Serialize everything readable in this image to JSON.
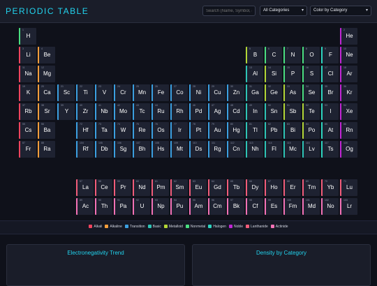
{
  "header": {
    "title": "PERIODIC TABLE",
    "search_placeholder": "Search (Name, Symbol, #",
    "category_select": "All Categories",
    "color_select": "Color by Category",
    "chevron": "▾"
  },
  "colors": {
    "alkali": "#f0445e",
    "alkaline": "#f59e3b",
    "transition": "#3b9fe0",
    "basic": "#2ec4b6",
    "metalloid": "#b3d636",
    "nonmetal": "#4ade80",
    "halogen": "#2dd4bf",
    "noble": "#c026d3",
    "lanthanide": "#f25c7a",
    "actinide": "#f472b6"
  },
  "elements": [
    {
      "n": "1",
      "s": "H",
      "r": 1,
      "c": 1,
      "cat": "nonmetal"
    },
    {
      "n": "2",
      "s": "He",
      "r": 1,
      "c": 18,
      "cat": "noble"
    },
    {
      "n": "3",
      "s": "Li",
      "r": 2,
      "c": 1,
      "cat": "alkali"
    },
    {
      "n": "4",
      "s": "Be",
      "r": 2,
      "c": 2,
      "cat": "alkaline"
    },
    {
      "n": "5",
      "s": "B",
      "r": 2,
      "c": 13,
      "cat": "metalloid"
    },
    {
      "n": "6",
      "s": "C",
      "r": 2,
      "c": 14,
      "cat": "nonmetal"
    },
    {
      "n": "7",
      "s": "N",
      "r": 2,
      "c": 15,
      "cat": "nonmetal"
    },
    {
      "n": "8",
      "s": "O",
      "r": 2,
      "c": 16,
      "cat": "nonmetal"
    },
    {
      "n": "9",
      "s": "F",
      "r": 2,
      "c": 17,
      "cat": "halogen"
    },
    {
      "n": "10",
      "s": "Ne",
      "r": 2,
      "c": 18,
      "cat": "noble"
    },
    {
      "n": "11",
      "s": "Na",
      "r": 3,
      "c": 1,
      "cat": "alkali"
    },
    {
      "n": "12",
      "s": "Mg",
      "r": 3,
      "c": 2,
      "cat": "alkaline"
    },
    {
      "n": "13",
      "s": "Al",
      "r": 3,
      "c": 13,
      "cat": "basic"
    },
    {
      "n": "14",
      "s": "Si",
      "r": 3,
      "c": 14,
      "cat": "metalloid"
    },
    {
      "n": "15",
      "s": "P",
      "r": 3,
      "c": 15,
      "cat": "nonmetal"
    },
    {
      "n": "16",
      "s": "S",
      "r": 3,
      "c": 16,
      "cat": "nonmetal"
    },
    {
      "n": "17",
      "s": "Cl",
      "r": 3,
      "c": 17,
      "cat": "halogen"
    },
    {
      "n": "18",
      "s": "Ar",
      "r": 3,
      "c": 18,
      "cat": "noble"
    },
    {
      "n": "19",
      "s": "K",
      "r": 4,
      "c": 1,
      "cat": "alkali"
    },
    {
      "n": "20",
      "s": "Ca",
      "r": 4,
      "c": 2,
      "cat": "alkaline"
    },
    {
      "n": "21",
      "s": "Sc",
      "r": 4,
      "c": 3,
      "cat": "transition"
    },
    {
      "n": "22",
      "s": "Ti",
      "r": 4,
      "c": 4,
      "cat": "transition"
    },
    {
      "n": "23",
      "s": "V",
      "r": 4,
      "c": 5,
      "cat": "transition"
    },
    {
      "n": "24",
      "s": "Cr",
      "r": 4,
      "c": 6,
      "cat": "transition"
    },
    {
      "n": "25",
      "s": "Mn",
      "r": 4,
      "c": 7,
      "cat": "transition"
    },
    {
      "n": "26",
      "s": "Fe",
      "r": 4,
      "c": 8,
      "cat": "transition"
    },
    {
      "n": "27",
      "s": "Co",
      "r": 4,
      "c": 9,
      "cat": "transition"
    },
    {
      "n": "28",
      "s": "Ni",
      "r": 4,
      "c": 10,
      "cat": "transition"
    },
    {
      "n": "29",
      "s": "Cu",
      "r": 4,
      "c": 11,
      "cat": "transition"
    },
    {
      "n": "30",
      "s": "Zn",
      "r": 4,
      "c": 12,
      "cat": "transition"
    },
    {
      "n": "31",
      "s": "Ga",
      "r": 4,
      "c": 13,
      "cat": "basic"
    },
    {
      "n": "32",
      "s": "Ge",
      "r": 4,
      "c": 14,
      "cat": "metalloid"
    },
    {
      "n": "33",
      "s": "As",
      "r": 4,
      "c": 15,
      "cat": "metalloid"
    },
    {
      "n": "34",
      "s": "Se",
      "r": 4,
      "c": 16,
      "cat": "nonmetal"
    },
    {
      "n": "35",
      "s": "Br",
      "r": 4,
      "c": 17,
      "cat": "halogen"
    },
    {
      "n": "36",
      "s": "Kr",
      "r": 4,
      "c": 18,
      "cat": "noble"
    },
    {
      "n": "37",
      "s": "Rb",
      "r": 5,
      "c": 1,
      "cat": "alkali"
    },
    {
      "n": "38",
      "s": "Sr",
      "r": 5,
      "c": 2,
      "cat": "alkaline"
    },
    {
      "n": "39",
      "s": "Y",
      "r": 5,
      "c": 3,
      "cat": "transition"
    },
    {
      "n": "40",
      "s": "Zr",
      "r": 5,
      "c": 4,
      "cat": "transition"
    },
    {
      "n": "41",
      "s": "Nb",
      "r": 5,
      "c": 5,
      "cat": "transition"
    },
    {
      "n": "42",
      "s": "Mo",
      "r": 5,
      "c": 6,
      "cat": "transition"
    },
    {
      "n": "43",
      "s": "Tc",
      "r": 5,
      "c": 7,
      "cat": "transition"
    },
    {
      "n": "44",
      "s": "Ru",
      "r": 5,
      "c": 8,
      "cat": "transition"
    },
    {
      "n": "45",
      "s": "Rh",
      "r": 5,
      "c": 9,
      "cat": "transition"
    },
    {
      "n": "46",
      "s": "Pd",
      "r": 5,
      "c": 10,
      "cat": "transition"
    },
    {
      "n": "47",
      "s": "Ag",
      "r": 5,
      "c": 11,
      "cat": "transition"
    },
    {
      "n": "48",
      "s": "Cd",
      "r": 5,
      "c": 12,
      "cat": "transition"
    },
    {
      "n": "49",
      "s": "In",
      "r": 5,
      "c": 13,
      "cat": "basic"
    },
    {
      "n": "50",
      "s": "Sn",
      "r": 5,
      "c": 14,
      "cat": "basic"
    },
    {
      "n": "51",
      "s": "Sb",
      "r": 5,
      "c": 15,
      "cat": "metalloid"
    },
    {
      "n": "52",
      "s": "Te",
      "r": 5,
      "c": 16,
      "cat": "metalloid"
    },
    {
      "n": "53",
      "s": "I",
      "r": 5,
      "c": 17,
      "cat": "halogen"
    },
    {
      "n": "54",
      "s": "Xe",
      "r": 5,
      "c": 18,
      "cat": "noble"
    },
    {
      "n": "55",
      "s": "Cs",
      "r": 6,
      "c": 1,
      "cat": "alkali"
    },
    {
      "n": "56",
      "s": "Ba",
      "r": 6,
      "c": 2,
      "cat": "alkaline"
    },
    {
      "n": "72",
      "s": "Hf",
      "r": 6,
      "c": 4,
      "cat": "transition"
    },
    {
      "n": "73",
      "s": "Ta",
      "r": 6,
      "c": 5,
      "cat": "transition"
    },
    {
      "n": "74",
      "s": "W",
      "r": 6,
      "c": 6,
      "cat": "transition"
    },
    {
      "n": "75",
      "s": "Re",
      "r": 6,
      "c": 7,
      "cat": "transition"
    },
    {
      "n": "76",
      "s": "Os",
      "r": 6,
      "c": 8,
      "cat": "transition"
    },
    {
      "n": "77",
      "s": "Ir",
      "r": 6,
      "c": 9,
      "cat": "transition"
    },
    {
      "n": "78",
      "s": "Pt",
      "r": 6,
      "c": 10,
      "cat": "transition"
    },
    {
      "n": "79",
      "s": "Au",
      "r": 6,
      "c": 11,
      "cat": "transition"
    },
    {
      "n": "80",
      "s": "Hg",
      "r": 6,
      "c": 12,
      "cat": "transition"
    },
    {
      "n": "81",
      "s": "Tl",
      "r": 6,
      "c": 13,
      "cat": "basic"
    },
    {
      "n": "82",
      "s": "Pb",
      "r": 6,
      "c": 14,
      "cat": "basic"
    },
    {
      "n": "83",
      "s": "Bi",
      "r": 6,
      "c": 15,
      "cat": "basic"
    },
    {
      "n": "84",
      "s": "Po",
      "r": 6,
      "c": 16,
      "cat": "metalloid"
    },
    {
      "n": "85",
      "s": "At",
      "r": 6,
      "c": 17,
      "cat": "halogen"
    },
    {
      "n": "86",
      "s": "Rn",
      "r": 6,
      "c": 18,
      "cat": "noble"
    },
    {
      "n": "87",
      "s": "Fr",
      "r": 7,
      "c": 1,
      "cat": "alkali"
    },
    {
      "n": "88",
      "s": "Ra",
      "r": 7,
      "c": 2,
      "cat": "alkaline"
    },
    {
      "n": "104",
      "s": "Rf",
      "r": 7,
      "c": 4,
      "cat": "transition"
    },
    {
      "n": "105",
      "s": "Db",
      "r": 7,
      "c": 5,
      "cat": "transition"
    },
    {
      "n": "106",
      "s": "Sg",
      "r": 7,
      "c": 6,
      "cat": "transition"
    },
    {
      "n": "107",
      "s": "Bh",
      "r": 7,
      "c": 7,
      "cat": "transition"
    },
    {
      "n": "108",
      "s": "Hs",
      "r": 7,
      "c": 8,
      "cat": "transition"
    },
    {
      "n": "109",
      "s": "Mt",
      "r": 7,
      "c": 9,
      "cat": "transition"
    },
    {
      "n": "110",
      "s": "Ds",
      "r": 7,
      "c": 10,
      "cat": "transition"
    },
    {
      "n": "111",
      "s": "Rg",
      "r": 7,
      "c": 11,
      "cat": "transition"
    },
    {
      "n": "112",
      "s": "Cn",
      "r": 7,
      "c": 12,
      "cat": "transition"
    },
    {
      "n": "113",
      "s": "Nh",
      "r": 7,
      "c": 13,
      "cat": "basic"
    },
    {
      "n": "114",
      "s": "Fl",
      "r": 7,
      "c": 14,
      "cat": "basic"
    },
    {
      "n": "115",
      "s": "Mc",
      "r": 7,
      "c": 15,
      "cat": "basic"
    },
    {
      "n": "116",
      "s": "Lv",
      "r": 7,
      "c": 16,
      "cat": "basic"
    },
    {
      "n": "117",
      "s": "Ts",
      "r": 7,
      "c": 17,
      "cat": "halogen"
    },
    {
      "n": "118",
      "s": "Og",
      "r": 7,
      "c": 18,
      "cat": "noble"
    },
    {
      "n": "57",
      "s": "La",
      "r": 9,
      "c": 4,
      "cat": "lanthanide"
    },
    {
      "n": "58",
      "s": "Ce",
      "r": 9,
      "c": 5,
      "cat": "lanthanide"
    },
    {
      "n": "59",
      "s": "Pr",
      "r": 9,
      "c": 6,
      "cat": "lanthanide"
    },
    {
      "n": "60",
      "s": "Nd",
      "r": 9,
      "c": 7,
      "cat": "lanthanide"
    },
    {
      "n": "61",
      "s": "Pm",
      "r": 9,
      "c": 8,
      "cat": "lanthanide"
    },
    {
      "n": "62",
      "s": "Sm",
      "r": 9,
      "c": 9,
      "cat": "lanthanide"
    },
    {
      "n": "63",
      "s": "Eu",
      "r": 9,
      "c": 10,
      "cat": "lanthanide"
    },
    {
      "n": "64",
      "s": "Gd",
      "r": 9,
      "c": 11,
      "cat": "lanthanide"
    },
    {
      "n": "65",
      "s": "Tb",
      "r": 9,
      "c": 12,
      "cat": "lanthanide"
    },
    {
      "n": "66",
      "s": "Dy",
      "r": 9,
      "c": 13,
      "cat": "lanthanide"
    },
    {
      "n": "67",
      "s": "Ho",
      "r": 9,
      "c": 14,
      "cat": "lanthanide"
    },
    {
      "n": "68",
      "s": "Er",
      "r": 9,
      "c": 15,
      "cat": "lanthanide"
    },
    {
      "n": "69",
      "s": "Tm",
      "r": 9,
      "c": 16,
      "cat": "lanthanide"
    },
    {
      "n": "70",
      "s": "Yb",
      "r": 9,
      "c": 17,
      "cat": "lanthanide"
    },
    {
      "n": "71",
      "s": "Lu",
      "r": 9,
      "c": 18,
      "cat": "lanthanide"
    },
    {
      "n": "89",
      "s": "Ac",
      "r": 10,
      "c": 4,
      "cat": "actinide"
    },
    {
      "n": "90",
      "s": "Th",
      "r": 10,
      "c": 5,
      "cat": "actinide"
    },
    {
      "n": "91",
      "s": "Pa",
      "r": 10,
      "c": 6,
      "cat": "actinide"
    },
    {
      "n": "92",
      "s": "U",
      "r": 10,
      "c": 7,
      "cat": "actinide"
    },
    {
      "n": "93",
      "s": "Np",
      "r": 10,
      "c": 8,
      "cat": "actinide"
    },
    {
      "n": "94",
      "s": "Pu",
      "r": 10,
      "c": 9,
      "cat": "actinide"
    },
    {
      "n": "95",
      "s": "Am",
      "r": 10,
      "c": 10,
      "cat": "actinide"
    },
    {
      "n": "96",
      "s": "Cm",
      "r": 10,
      "c": 11,
      "cat": "actinide"
    },
    {
      "n": "97",
      "s": "Bk",
      "r": 10,
      "c": 12,
      "cat": "actinide"
    },
    {
      "n": "98",
      "s": "Cf",
      "r": 10,
      "c": 13,
      "cat": "actinide"
    },
    {
      "n": "99",
      "s": "Es",
      "r": 10,
      "c": 14,
      "cat": "actinide"
    },
    {
      "n": "100",
      "s": "Fm",
      "r": 10,
      "c": 15,
      "cat": "actinide"
    },
    {
      "n": "101",
      "s": "Md",
      "r": 10,
      "c": 16,
      "cat": "actinide"
    },
    {
      "n": "102",
      "s": "No",
      "r": 10,
      "c": 17,
      "cat": "actinide"
    },
    {
      "n": "103",
      "s": "Lr",
      "r": 10,
      "c": 18,
      "cat": "actinide"
    }
  ],
  "legend": [
    {
      "label": "Alkali",
      "cat": "alkali"
    },
    {
      "label": "Alkaline",
      "cat": "alkaline"
    },
    {
      "label": "Transition",
      "cat": "transition"
    },
    {
      "label": "Basic",
      "cat": "basic"
    },
    {
      "label": "Metalloid",
      "cat": "metalloid"
    },
    {
      "label": "Nonmetal",
      "cat": "nonmetal"
    },
    {
      "label": "Halogen",
      "cat": "halogen"
    },
    {
      "label": "Noble",
      "cat": "noble"
    },
    {
      "label": "Lanthanide",
      "cat": "lanthanide"
    },
    {
      "label": "Actinide",
      "cat": "actinide"
    }
  ],
  "panels": {
    "electronegativity_title": "Electronegativity Trend",
    "density_title": "Density by Category"
  }
}
